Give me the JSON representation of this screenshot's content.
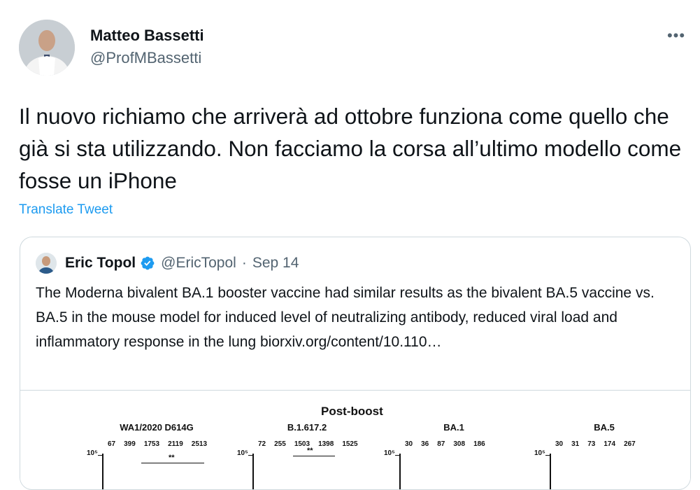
{
  "tweet": {
    "author_name": "Matteo Bassetti",
    "author_handle": "@ProfMBassetti",
    "more_label": "•••",
    "text": "Il nuovo richiamo che arriverà ad ottobre funziona come quello che già si sta utilizzando. Non facciamo la corsa all’ultimo modello come fosse un iPhone",
    "translate_label": "Translate Tweet"
  },
  "quote": {
    "author_name": "Eric Topol",
    "author_handle": "@EricTopol",
    "separator": "·",
    "date": "Sep 14",
    "text": "The Moderna bivalent BA.1 booster vaccine had similar results as the bivalent BA.5 vaccine vs. BA.5 in the mouse model for induced level of neutralizing antibody, reduced viral load and inflammatory response in the lung biorxiv.org/content/10.110…",
    "figure": {
      "title": "Post-boost",
      "panels": [
        {
          "title": "WA1/2020 D614G",
          "values": [
            "67",
            "399",
            "1753",
            "2119",
            "2513"
          ],
          "sig": "**"
        },
        {
          "title": "B.1.617.2",
          "values": [
            "72",
            "255",
            "1503",
            "1398",
            "1525"
          ],
          "sig": "**"
        },
        {
          "title": "BA.1",
          "values": [
            "30",
            "36",
            "87",
            "308",
            "186"
          ],
          "sig": ""
        },
        {
          "title": "BA.5",
          "values": [
            "30",
            "31",
            "73",
            "174",
            "267"
          ],
          "sig": ""
        }
      ],
      "y_tick_label": "10⁵"
    }
  },
  "colors": {
    "link": "#1d9bf0",
    "secondary_text": "#536471",
    "border": "#cfd9de",
    "verified": "#1d9bf0"
  },
  "icons": {
    "more": "ellipsis-icon",
    "verified": "verified-badge-icon"
  }
}
